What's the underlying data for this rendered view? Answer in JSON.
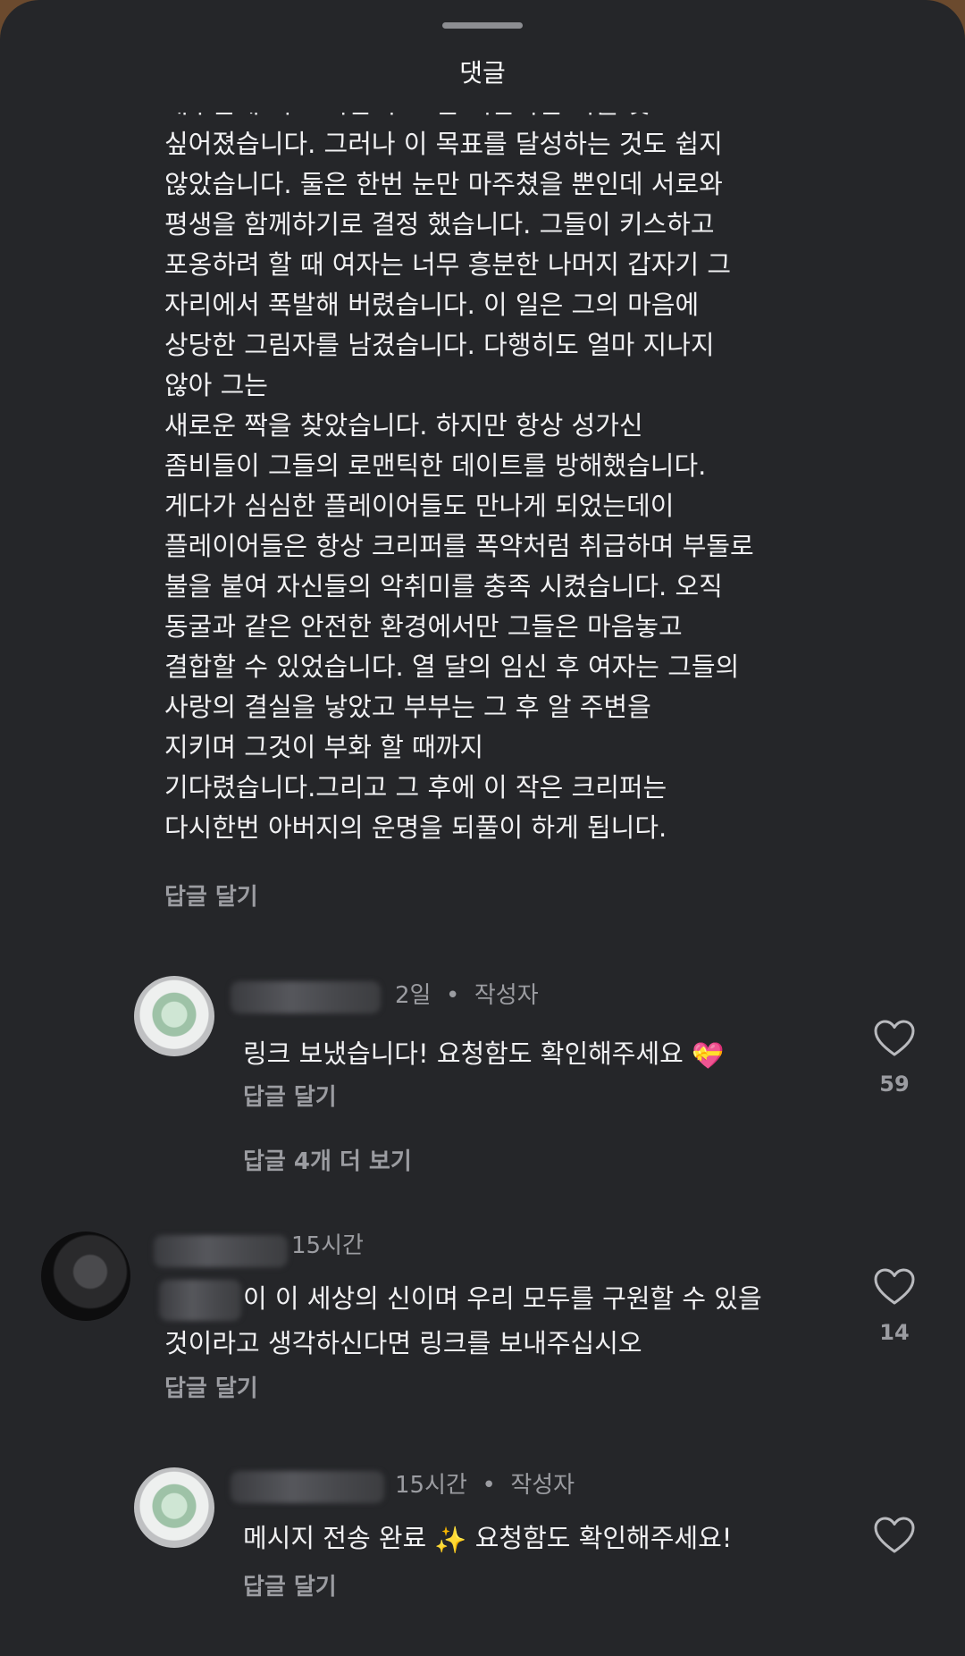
{
  "sheet": {
    "title": "댓글"
  },
  "top_comment": {
    "text": "배우는게 먹고 비만 후 그는 어름다운 짝을 찾고\n싶어졌습니다. 그러나 이 목표를 달성하는 것도 쉽지\n않았습니다. 둘은 한번 눈만 마주쳤을 뿐인데 서로와\n평생을 함께하기로 결정 했습니다. 그들이 키스하고\n포옹하려 할 때 여자는 너무 흥분한 나머지 갑자기 그\n자리에서 폭발해 버렸습니다. 이 일은 그의 마음에\n상당한 그림자를 남겼습니다. 다행히도 얼마 지나지\n않아 그는\n새로운 짝을 찾았습니다. 하지만 항상 성가신\n좀비들이 그들의 로맨틱한 데이트를 방해했습니다.\n게다가 심심한 플레이어들도 만나게 되었는데이\n플레이어들은 항상 크리퍼를 폭약처럼 취급하며 부돌로\n불을 붙여 자신들의 악취미를 충족 시켰습니다. 오직\n동굴과 같은 안전한 환경에서만 그들은 마음놓고\n결합할 수 있었습니다. 열 달의 임신 후 여자는 그들의\n사랑의 결실을 낳았고 부부는 그 후 알 주변을\n지키며 그것이 부화 할 때까지\n기다렸습니다.그리고 그 후에 이 작은 크리퍼는\n다시한번 아버지의 운명을 되풀이 하게 됩니다.",
    "reply_label": "답글 달기"
  },
  "replies": [
    {
      "time": "2일",
      "separator": "•",
      "author_badge": "작성자",
      "text": "링크 보냈습니다! 요청함도 확인해주세요",
      "emoji": "💝",
      "reply_label": "답글 달기",
      "likes": "59",
      "more_replies": "답글 4개 더 보기"
    },
    {
      "time": "15시간",
      "text_line1": "이 이 세상의 신이며 우리 모두를 구원할 수 있을",
      "text_line2": "것이라고 생각하신다면 링크를 보내주십시오",
      "reply_label": "답글 달기",
      "likes": "14"
    },
    {
      "time": "15시간",
      "separator": "•",
      "author_badge": "작성자",
      "text": "메시지 전송 완료",
      "emoji": "✨",
      "text_after": "요청함도 확인해주세요!",
      "reply_label": "답글 달기"
    }
  ],
  "icons": {
    "like": "heart-outline-icon"
  },
  "colors": {
    "background": "#252629",
    "text": "#f1f1f3",
    "muted": "#9b9ca1"
  }
}
